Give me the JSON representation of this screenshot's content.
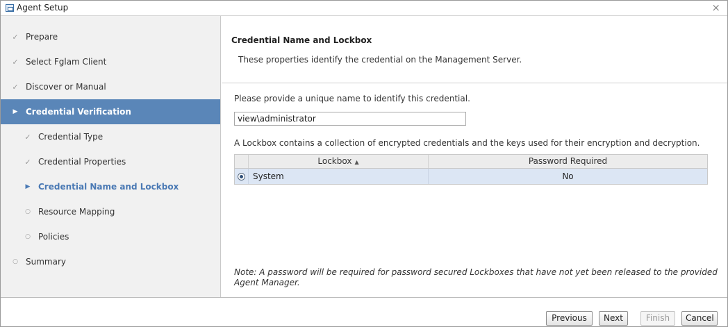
{
  "window": {
    "title": "Agent Setup",
    "close_glyph": "×"
  },
  "steps": [
    {
      "label": "Prepare",
      "state": "done"
    },
    {
      "label": "Select Fglam Client",
      "state": "done"
    },
    {
      "label": "Discover or Manual",
      "state": "done"
    },
    {
      "label": "Credential Verification",
      "state": "active"
    },
    {
      "label": "Credential Type",
      "state": "done"
    },
    {
      "label": "Credential Properties",
      "state": "done"
    },
    {
      "label": "Credential Name and Lockbox",
      "state": "current"
    },
    {
      "label": "Resource Mapping",
      "state": "pending"
    },
    {
      "label": "Policies",
      "state": "pending"
    },
    {
      "label": "Summary",
      "state": "pending"
    }
  ],
  "glyphs": {
    "done": "✓",
    "active": "▶",
    "pending": "○"
  },
  "content": {
    "title": "Credential Name and Lockbox",
    "description": "These properties identify the credential on the Management Server.",
    "name_prompt": "Please provide a unique name to identify this credential.",
    "name_value": "view\\administrator",
    "lockbox_description": "A Lockbox contains a collection of encrypted credentials and the keys used for their encryption and decryption.",
    "grid": {
      "columns": [
        "Lockbox",
        "Password Required"
      ],
      "sort_glyph": "▲",
      "rows": [
        {
          "lockbox": "System",
          "password_required": "No",
          "selected": true
        }
      ]
    },
    "note": "Note: A password will be required for password secured Lockboxes that have not yet been released to the provided Agent Manager."
  },
  "footer": {
    "previous": "Previous",
    "next": "Next",
    "finish": "Finish",
    "cancel": "Cancel"
  },
  "colors": {
    "active_step_bg": "#5a86b8",
    "current_sub_text": "#4a79b4",
    "selected_row_bg": "#dce6f4"
  }
}
